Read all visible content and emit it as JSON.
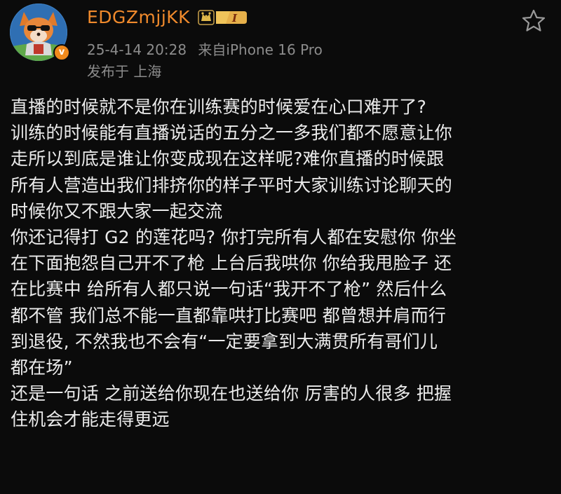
{
  "header": {
    "username": "EDGZmjjKK",
    "member_level": "I",
    "verified_mark": "v",
    "timestamp": "25-4-14 20:28",
    "source": "来自iPhone 16 Pro",
    "location": "发布于 上海"
  },
  "icons": {
    "favorite": "star-outline-icon",
    "crown": "crown-icon",
    "verified": "verified-badge-icon"
  },
  "colors": {
    "background": "#0b0b0b",
    "username": "#f08a2c",
    "meta": "#8c8c8c",
    "body_text": "#ebebeb",
    "badge": "#f08a1c"
  },
  "post": {
    "lines": [
      "直播的时候就不是你在训练赛的时候爱在心口难开了?",
      "训练的时候能有直播说话的五分之一多我们都不愿意让你",
      "走所以到底是谁让你变成现在这样呢?难你直播的时候跟",
      "所有人营造出我们排挤你的样子平时大家训练讨论聊天的",
      "时候你又不跟大家一起交流",
      "你还记得打 G2 的莲花吗? 你打完所有人都在安慰你 你坐",
      "在下面抱怨自己开不了枪 上台后我哄你 你给我甩脸子 还",
      "在比赛中 给所有人都只说一句话“我开不了枪” 然后什么",
      "都不管 我们总不能一直都靠哄打比赛吧 都曾想并肩而行",
      "到退役, 不然我也不会有“一定要拿到大满贯所有哥们儿",
      "都在场”",
      "还是一句话 之前送给你现在也送给你 厉害的人很多 把握",
      "住机会才能走得更远"
    ]
  }
}
